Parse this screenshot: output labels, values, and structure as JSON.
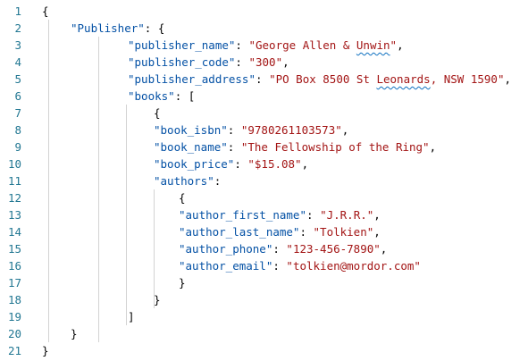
{
  "editor": {
    "lines": [
      {
        "n": "1",
        "indent": 0,
        "segments": [
          {
            "t": "{",
            "c": "pun"
          }
        ]
      },
      {
        "n": "2",
        "indent": 1,
        "segments": [
          {
            "t": "\"Publisher\"",
            "c": "key"
          },
          {
            "t": ": {",
            "c": "pun"
          }
        ]
      },
      {
        "n": "3",
        "indent": 2,
        "segments": [
          {
            "t": "\"publisher_name\"",
            "c": "key"
          },
          {
            "t": ": ",
            "c": "pun"
          },
          {
            "t": "\"George Allen & ",
            "c": "str"
          },
          {
            "t": "Unwin",
            "c": "str",
            "squiggle": true
          },
          {
            "t": "\"",
            "c": "str"
          },
          {
            "t": ",",
            "c": "pun"
          }
        ]
      },
      {
        "n": "4",
        "indent": 2,
        "segments": [
          {
            "t": "\"publisher_code\"",
            "c": "key"
          },
          {
            "t": ": ",
            "c": "pun"
          },
          {
            "t": "\"300\"",
            "c": "str"
          },
          {
            "t": ",",
            "c": "pun"
          }
        ]
      },
      {
        "n": "5",
        "indent": 2,
        "segments": [
          {
            "t": "\"publisher_address\"",
            "c": "key"
          },
          {
            "t": ": ",
            "c": "pun"
          },
          {
            "t": "\"PO Box 8500 St ",
            "c": "str"
          },
          {
            "t": "Leonards",
            "c": "str",
            "squiggle": true
          },
          {
            "t": ", NSW 1590\"",
            "c": "str"
          },
          {
            "t": ",",
            "c": "pun"
          }
        ]
      },
      {
        "n": "6",
        "indent": 2,
        "segments": [
          {
            "t": "\"books\"",
            "c": "key"
          },
          {
            "t": ": [",
            "c": "pun"
          }
        ]
      },
      {
        "n": "7",
        "indent": 3,
        "segments": [
          {
            "t": "{",
            "c": "pun"
          }
        ]
      },
      {
        "n": "8",
        "indent": 3,
        "segments": [
          {
            "t": "\"book_isbn\"",
            "c": "key"
          },
          {
            "t": ": ",
            "c": "pun"
          },
          {
            "t": "\"9780261103573\"",
            "c": "str"
          },
          {
            "t": ",",
            "c": "pun"
          }
        ]
      },
      {
        "n": "9",
        "indent": 3,
        "segments": [
          {
            "t": "\"book_name\"",
            "c": "key"
          },
          {
            "t": ": ",
            "c": "pun"
          },
          {
            "t": "\"The Fellowship of the Ring\"",
            "c": "str"
          },
          {
            "t": ",",
            "c": "pun"
          }
        ]
      },
      {
        "n": "10",
        "indent": 3,
        "segments": [
          {
            "t": "\"book_price\"",
            "c": "key"
          },
          {
            "t": ": ",
            "c": "pun"
          },
          {
            "t": "\"$15.08\"",
            "c": "str"
          },
          {
            "t": ",",
            "c": "pun"
          }
        ]
      },
      {
        "n": "11",
        "indent": 3,
        "segments": [
          {
            "t": "\"authors\"",
            "c": "key"
          },
          {
            "t": ":",
            "c": "pun"
          }
        ]
      },
      {
        "n": "12",
        "indent": 4,
        "segments": [
          {
            "t": "{",
            "c": "pun"
          }
        ]
      },
      {
        "n": "13",
        "indent": 4,
        "segments": [
          {
            "t": "\"author_first_name\"",
            "c": "key"
          },
          {
            "t": ": ",
            "c": "pun"
          },
          {
            "t": "\"J.R.R.\"",
            "c": "str"
          },
          {
            "t": ",",
            "c": "pun"
          }
        ]
      },
      {
        "n": "14",
        "indent": 4,
        "segments": [
          {
            "t": "\"author_last_name\"",
            "c": "key"
          },
          {
            "t": ": ",
            "c": "pun"
          },
          {
            "t": "\"Tolkien\"",
            "c": "str"
          },
          {
            "t": ",",
            "c": "pun"
          }
        ]
      },
      {
        "n": "15",
        "indent": 4,
        "segments": [
          {
            "t": "\"author_phone\"",
            "c": "key"
          },
          {
            "t": ": ",
            "c": "pun"
          },
          {
            "t": "\"123-456-7890\"",
            "c": "str"
          },
          {
            "t": ",",
            "c": "pun"
          }
        ]
      },
      {
        "n": "16",
        "indent": 4,
        "segments": [
          {
            "t": "\"author_email\"",
            "c": "key"
          },
          {
            "t": ": ",
            "c": "pun"
          },
          {
            "t": "\"tolkien@mordor.com\"",
            "c": "str"
          }
        ]
      },
      {
        "n": "17",
        "indent": 4,
        "segments": [
          {
            "t": "}",
            "c": "pun"
          }
        ]
      },
      {
        "n": "18",
        "indent": 3,
        "segments": [
          {
            "t": "}",
            "c": "pun"
          }
        ]
      },
      {
        "n": "19",
        "indent": 2,
        "segments": [
          {
            "t": "]",
            "c": "pun"
          }
        ]
      },
      {
        "n": "20",
        "indent": 1,
        "segments": [
          {
            "t": "}",
            "c": "pun"
          }
        ]
      },
      {
        "n": "21",
        "indent": 0,
        "segments": [
          {
            "t": "}",
            "c": "pun"
          }
        ]
      }
    ],
    "guides": [
      {
        "level": 1,
        "from": 1,
        "to": 19
      },
      {
        "level": 2,
        "from": 2,
        "to": 19
      },
      {
        "level": 3,
        "from": 6,
        "to": 18
      },
      {
        "level": 4,
        "from": 11,
        "to": 17
      }
    ]
  }
}
